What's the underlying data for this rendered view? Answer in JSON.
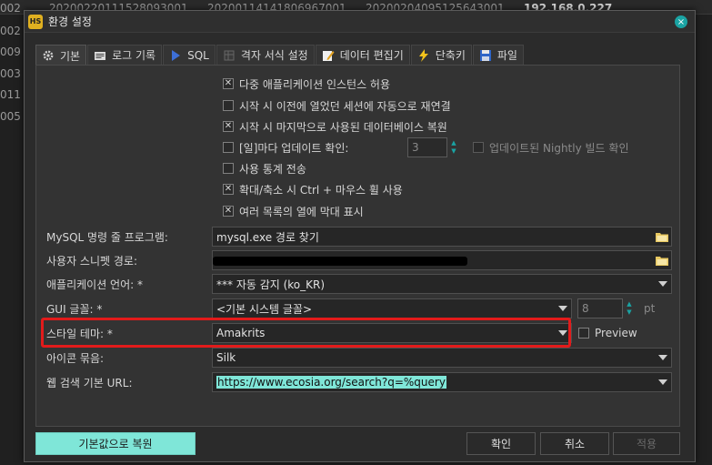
{
  "background": {
    "top_values": [
      "20200220111528093001",
      "20200114141806967001",
      "20200204095125643001",
      "192.168.0.227"
    ],
    "left_values": [
      "002",
      "002",
      "009",
      "003",
      "011",
      "005"
    ],
    "right_values": [
      "0",
      "0"
    ]
  },
  "dialog": {
    "app_icon_text": "HS",
    "title": "환경 설정",
    "close_glyph": "×"
  },
  "tabs": [
    {
      "label": "기본",
      "icon": "gear-icon"
    },
    {
      "label": "로그 기록",
      "icon": "log-icon"
    },
    {
      "label": "SQL",
      "icon": "sql-arrow-icon"
    },
    {
      "label": "격자 서식 설정",
      "icon": "grid-icon"
    },
    {
      "label": "데이터 편집기",
      "icon": "edit-icon"
    },
    {
      "label": "단축키",
      "icon": "lightning-icon"
    },
    {
      "label": "파일",
      "icon": "save-icon"
    }
  ],
  "checkboxes": [
    {
      "label": "다중 애플리케이션 인스턴스 허용",
      "checked": true
    },
    {
      "label": "시작 시 이전에 열었던 세션에 자동으로 재연결",
      "checked": false
    },
    {
      "label": "시작 시 마지막으로 사용된 데이터베이스 복원",
      "checked": true
    },
    {
      "label": "[일]마다 업데이트 확인:",
      "checked": false
    },
    {
      "label": "사용 통계 전송",
      "checked": false
    },
    {
      "label": "확대/축소 시 Ctrl + 마우스 휠 사용",
      "checked": true
    },
    {
      "label": "여러 목록의 열에 막대 표시",
      "checked": true
    }
  ],
  "update_interval": {
    "value": "3"
  },
  "nightly": {
    "label": "업데이트된 Nightly 빌드 확인",
    "checked": false
  },
  "fields": {
    "mysql_label": "MySQL 명령 줄 프로그램:",
    "mysql_value": "mysql.exe 경로 찾기",
    "snippets_label": "사용자 스니펫 경로:",
    "snippets_value": "",
    "language_label": "애플리케이션 언어: *",
    "language_value": "*** 자동 감지 (ko_KR)",
    "gui_font_label": "GUI 글꼴: *",
    "gui_font_value": "<기본 시스템 글꼴>",
    "font_size_value": "8",
    "font_size_unit": "pt",
    "theme_label": "스타일 테마: *",
    "theme_value": "Amakrits",
    "preview_label": "Preview",
    "iconpack_label": "아이콘 묶음:",
    "iconpack_value": "Silk",
    "websearch_label": "웹 검색 기본 URL:",
    "websearch_value": "https://www.ecosia.org/search?q=%query"
  },
  "buttons": {
    "restore_defaults": "기본값으로 복원",
    "ok": "확인",
    "cancel": "취소",
    "apply": "적용"
  },
  "colors": {
    "accent": "#1aa3a3",
    "highlight_box": "#e21b1b",
    "restore_button": "#7fe6d8"
  }
}
